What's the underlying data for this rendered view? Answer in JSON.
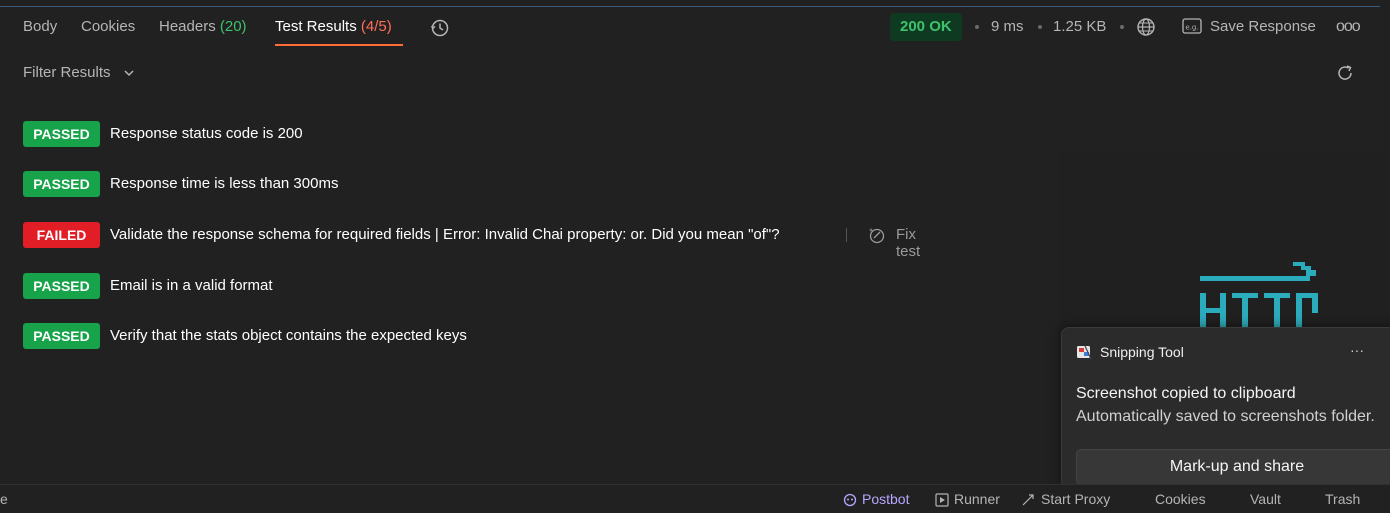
{
  "tabs": {
    "body": "Body",
    "cookies": "Cookies",
    "headers_label": "Headers",
    "headers_count": "(20)",
    "test_results_label": "Test Results",
    "test_results_count": "(4/5)"
  },
  "response": {
    "status": "200 OK",
    "time": "9 ms",
    "size": "1.25 KB",
    "save_label": "Save Response",
    "more": "ooo"
  },
  "filter": {
    "label": "Filter Results"
  },
  "results": [
    {
      "status": "PASSED",
      "text": "Response status code is 200"
    },
    {
      "status": "PASSED",
      "text": "Response time is less than 300ms"
    },
    {
      "status": "FAILED",
      "text": "Validate the response schema for required fields | Error: Invalid Chai property: or. Did you mean \"of\"?",
      "fix": "Fix test"
    },
    {
      "status": "PASSED",
      "text": "Email is in a valid format"
    },
    {
      "status": "PASSED",
      "text": "Verify that the stats object contains the expected keys"
    }
  ],
  "bottombar": {
    "left": "e",
    "postbot": "Postbot",
    "runner": "Runner",
    "start_proxy": "Start Proxy",
    "cookies": "Cookies",
    "vault": "Vault",
    "trash": "Trash"
  },
  "toast": {
    "app": "Snipping Tool",
    "more": "···",
    "title": "Screenshot copied to clipboard",
    "body": "Automatically saved to screenshots folder.",
    "button": "Mark-up and share"
  },
  "colors": {
    "passed": "#16a34a",
    "failed": "#e11d26",
    "accent": "#ff6c37",
    "status_ok": "#3ec26b"
  }
}
